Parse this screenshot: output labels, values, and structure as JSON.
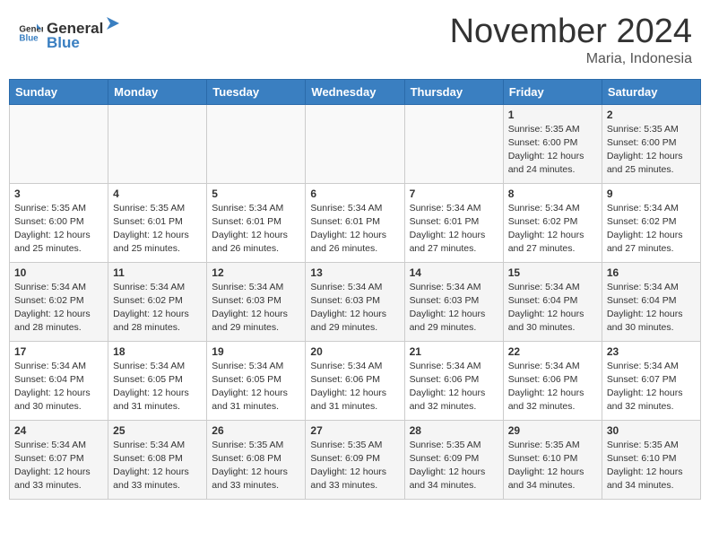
{
  "header": {
    "logo_general": "General",
    "logo_blue": "Blue",
    "month_year": "November 2024",
    "location": "Maria, Indonesia"
  },
  "weekdays": [
    "Sunday",
    "Monday",
    "Tuesday",
    "Wednesday",
    "Thursday",
    "Friday",
    "Saturday"
  ],
  "weeks": [
    [
      {
        "day": "",
        "info": ""
      },
      {
        "day": "",
        "info": ""
      },
      {
        "day": "",
        "info": ""
      },
      {
        "day": "",
        "info": ""
      },
      {
        "day": "",
        "info": ""
      },
      {
        "day": "1",
        "info": "Sunrise: 5:35 AM\nSunset: 6:00 PM\nDaylight: 12 hours\nand 24 minutes."
      },
      {
        "day": "2",
        "info": "Sunrise: 5:35 AM\nSunset: 6:00 PM\nDaylight: 12 hours\nand 25 minutes."
      }
    ],
    [
      {
        "day": "3",
        "info": "Sunrise: 5:35 AM\nSunset: 6:00 PM\nDaylight: 12 hours\nand 25 minutes."
      },
      {
        "day": "4",
        "info": "Sunrise: 5:35 AM\nSunset: 6:01 PM\nDaylight: 12 hours\nand 25 minutes."
      },
      {
        "day": "5",
        "info": "Sunrise: 5:34 AM\nSunset: 6:01 PM\nDaylight: 12 hours\nand 26 minutes."
      },
      {
        "day": "6",
        "info": "Sunrise: 5:34 AM\nSunset: 6:01 PM\nDaylight: 12 hours\nand 26 minutes."
      },
      {
        "day": "7",
        "info": "Sunrise: 5:34 AM\nSunset: 6:01 PM\nDaylight: 12 hours\nand 27 minutes."
      },
      {
        "day": "8",
        "info": "Sunrise: 5:34 AM\nSunset: 6:02 PM\nDaylight: 12 hours\nand 27 minutes."
      },
      {
        "day": "9",
        "info": "Sunrise: 5:34 AM\nSunset: 6:02 PM\nDaylight: 12 hours\nand 27 minutes."
      }
    ],
    [
      {
        "day": "10",
        "info": "Sunrise: 5:34 AM\nSunset: 6:02 PM\nDaylight: 12 hours\nand 28 minutes."
      },
      {
        "day": "11",
        "info": "Sunrise: 5:34 AM\nSunset: 6:02 PM\nDaylight: 12 hours\nand 28 minutes."
      },
      {
        "day": "12",
        "info": "Sunrise: 5:34 AM\nSunset: 6:03 PM\nDaylight: 12 hours\nand 29 minutes."
      },
      {
        "day": "13",
        "info": "Sunrise: 5:34 AM\nSunset: 6:03 PM\nDaylight: 12 hours\nand 29 minutes."
      },
      {
        "day": "14",
        "info": "Sunrise: 5:34 AM\nSunset: 6:03 PM\nDaylight: 12 hours\nand 29 minutes."
      },
      {
        "day": "15",
        "info": "Sunrise: 5:34 AM\nSunset: 6:04 PM\nDaylight: 12 hours\nand 30 minutes."
      },
      {
        "day": "16",
        "info": "Sunrise: 5:34 AM\nSunset: 6:04 PM\nDaylight: 12 hours\nand 30 minutes."
      }
    ],
    [
      {
        "day": "17",
        "info": "Sunrise: 5:34 AM\nSunset: 6:04 PM\nDaylight: 12 hours\nand 30 minutes."
      },
      {
        "day": "18",
        "info": "Sunrise: 5:34 AM\nSunset: 6:05 PM\nDaylight: 12 hours\nand 31 minutes."
      },
      {
        "day": "19",
        "info": "Sunrise: 5:34 AM\nSunset: 6:05 PM\nDaylight: 12 hours\nand 31 minutes."
      },
      {
        "day": "20",
        "info": "Sunrise: 5:34 AM\nSunset: 6:06 PM\nDaylight: 12 hours\nand 31 minutes."
      },
      {
        "day": "21",
        "info": "Sunrise: 5:34 AM\nSunset: 6:06 PM\nDaylight: 12 hours\nand 32 minutes."
      },
      {
        "day": "22",
        "info": "Sunrise: 5:34 AM\nSunset: 6:06 PM\nDaylight: 12 hours\nand 32 minutes."
      },
      {
        "day": "23",
        "info": "Sunrise: 5:34 AM\nSunset: 6:07 PM\nDaylight: 12 hours\nand 32 minutes."
      }
    ],
    [
      {
        "day": "24",
        "info": "Sunrise: 5:34 AM\nSunset: 6:07 PM\nDaylight: 12 hours\nand 33 minutes."
      },
      {
        "day": "25",
        "info": "Sunrise: 5:34 AM\nSunset: 6:08 PM\nDaylight: 12 hours\nand 33 minutes."
      },
      {
        "day": "26",
        "info": "Sunrise: 5:35 AM\nSunset: 6:08 PM\nDaylight: 12 hours\nand 33 minutes."
      },
      {
        "day": "27",
        "info": "Sunrise: 5:35 AM\nSunset: 6:09 PM\nDaylight: 12 hours\nand 33 minutes."
      },
      {
        "day": "28",
        "info": "Sunrise: 5:35 AM\nSunset: 6:09 PM\nDaylight: 12 hours\nand 34 minutes."
      },
      {
        "day": "29",
        "info": "Sunrise: 5:35 AM\nSunset: 6:10 PM\nDaylight: 12 hours\nand 34 minutes."
      },
      {
        "day": "30",
        "info": "Sunrise: 5:35 AM\nSunset: 6:10 PM\nDaylight: 12 hours\nand 34 minutes."
      }
    ]
  ]
}
